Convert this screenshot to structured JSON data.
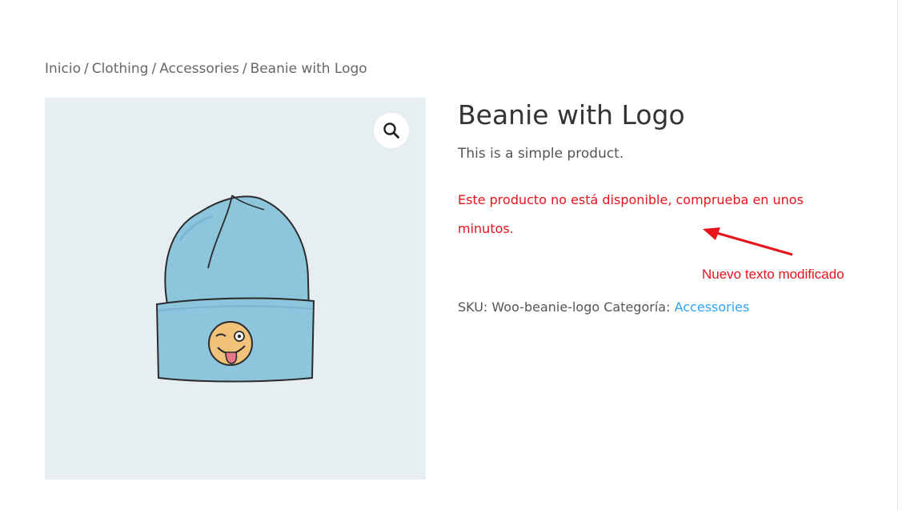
{
  "breadcrumb": {
    "items": [
      "Inicio",
      "Clothing",
      "Accessories",
      "Beanie with Logo"
    ],
    "separator": "/"
  },
  "product": {
    "title": "Beanie with Logo",
    "short_description": "This is a simple product.",
    "stock_message": "Este producto no está disponible, comprueba en unos minutos.",
    "sku_label": "SKU:",
    "sku_value": "Woo-beanie-logo",
    "category_label": "Categoría:",
    "category_value": "Accessories"
  },
  "annotation": {
    "text": "Nuevo texto modificado",
    "color": "#e8141b"
  },
  "icons": {
    "zoom": "magnifier-icon"
  },
  "colors": {
    "image_bg": "#e7eef2",
    "beanie": "#8cc5dc",
    "link": "#2ea3f2",
    "stock_message": "#e8141b"
  }
}
